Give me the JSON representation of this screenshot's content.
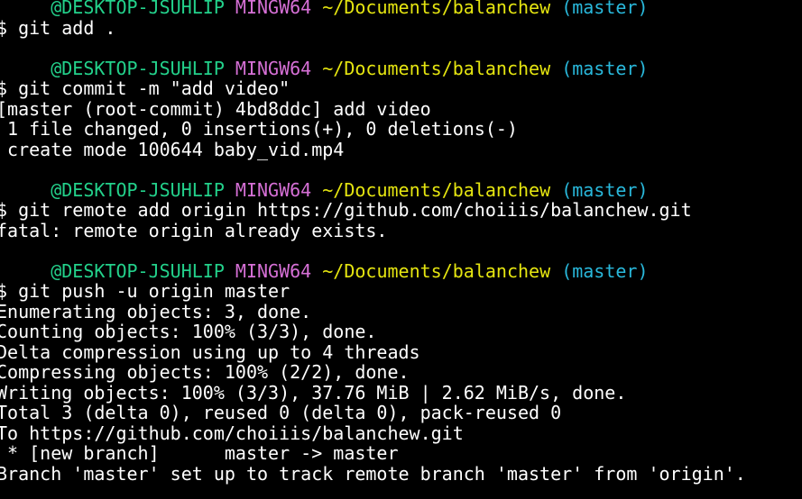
{
  "colors": {
    "background": "#000000",
    "default": "#ffffff",
    "green": "#23d18b",
    "magenta": "#d670d6",
    "yellow": "#e5e510",
    "cyan": "#29b8db"
  },
  "terminal": {
    "lines": [
      [
        {
          "text": "     "
        },
        {
          "text": "@DESKTOP-JSUHLIP",
          "color": "green"
        },
        {
          "text": " "
        },
        {
          "text": "MINGW64",
          "color": "magenta"
        },
        {
          "text": " "
        },
        {
          "text": "~/Documents/balanchew",
          "color": "yellow"
        },
        {
          "text": " "
        },
        {
          "text": "(master)",
          "color": "cyan"
        }
      ],
      [
        {
          "text": "$ git add ."
        }
      ],
      [
        {
          "text": ""
        }
      ],
      [
        {
          "text": "     "
        },
        {
          "text": "@DESKTOP-JSUHLIP",
          "color": "green"
        },
        {
          "text": " "
        },
        {
          "text": "MINGW64",
          "color": "magenta"
        },
        {
          "text": " "
        },
        {
          "text": "~/Documents/balanchew",
          "color": "yellow"
        },
        {
          "text": " "
        },
        {
          "text": "(master)",
          "color": "cyan"
        }
      ],
      [
        {
          "text": "$ git commit -m \"add video\""
        }
      ],
      [
        {
          "text": "[master (root-commit) 4bd8ddc] add video"
        }
      ],
      [
        {
          "text": " 1 file changed, 0 insertions(+), 0 deletions(-)"
        }
      ],
      [
        {
          "text": " create mode 100644 baby_vid.mp4"
        }
      ],
      [
        {
          "text": ""
        }
      ],
      [
        {
          "text": "     "
        },
        {
          "text": "@DESKTOP-JSUHLIP",
          "color": "green"
        },
        {
          "text": " "
        },
        {
          "text": "MINGW64",
          "color": "magenta"
        },
        {
          "text": " "
        },
        {
          "text": "~/Documents/balanchew",
          "color": "yellow"
        },
        {
          "text": " "
        },
        {
          "text": "(master)",
          "color": "cyan"
        }
      ],
      [
        {
          "text": "$ git remote add origin https://github.com/choiiis/balanchew.git"
        }
      ],
      [
        {
          "text": "fatal: remote origin already exists."
        }
      ],
      [
        {
          "text": ""
        }
      ],
      [
        {
          "text": "     "
        },
        {
          "text": "@DESKTOP-JSUHLIP",
          "color": "green"
        },
        {
          "text": " "
        },
        {
          "text": "MINGW64",
          "color": "magenta"
        },
        {
          "text": " "
        },
        {
          "text": "~/Documents/balanchew",
          "color": "yellow"
        },
        {
          "text": " "
        },
        {
          "text": "(master)",
          "color": "cyan"
        }
      ],
      [
        {
          "text": "$ git push -u origin master"
        }
      ],
      [
        {
          "text": "Enumerating objects: 3, done."
        }
      ],
      [
        {
          "text": "Counting objects: 100% (3/3), done."
        }
      ],
      [
        {
          "text": "Delta compression using up to 4 threads"
        }
      ],
      [
        {
          "text": "Compressing objects: 100% (2/2), done."
        }
      ],
      [
        {
          "text": "Writing objects: 100% (3/3), 37.76 MiB | 2.62 MiB/s, done."
        }
      ],
      [
        {
          "text": "Total 3 (delta 0), reused 0 (delta 0), pack-reused 0"
        }
      ],
      [
        {
          "text": "To https://github.com/choiiis/balanchew.git"
        }
      ],
      [
        {
          "text": " * [new branch]      master -> master"
        }
      ],
      [
        {
          "text": "Branch 'master' set up to track remote branch 'master' from 'origin'."
        }
      ]
    ]
  }
}
